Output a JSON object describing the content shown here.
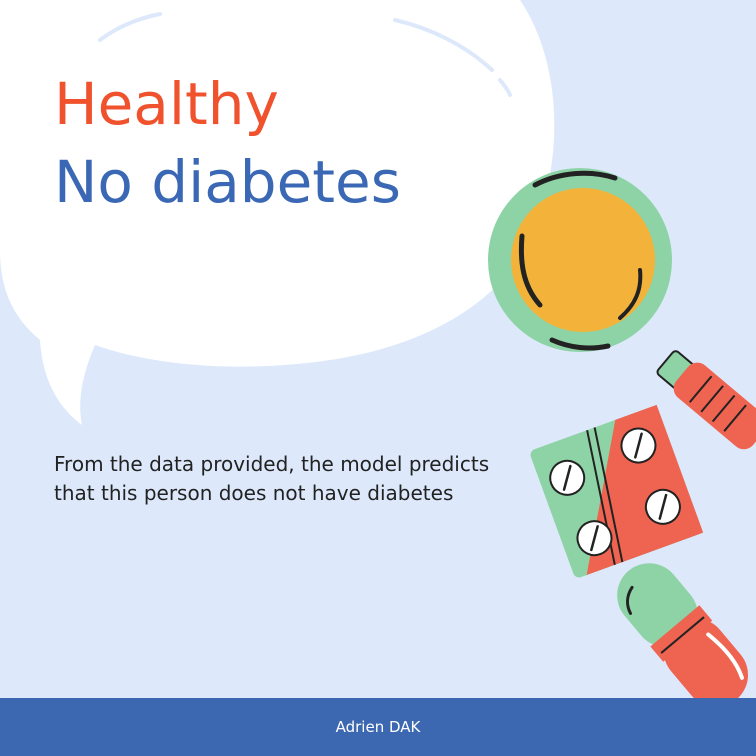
{
  "heading": {
    "line1": "Healthy",
    "line2": "No diabetes"
  },
  "message": "From the data provided, the model predicts that this person does not have diabetes",
  "footer": {
    "author": "Adrien DAK"
  },
  "colors": {
    "background": "#dde9fb",
    "heading_line1": "#f0522e",
    "heading_line2": "#3a68b5",
    "footer_bar": "#3c68b1"
  },
  "illustrations": [
    "speech-bubble",
    "magnifying-glass-icon",
    "pill-blister-pack-icon",
    "capsule-icon"
  ]
}
